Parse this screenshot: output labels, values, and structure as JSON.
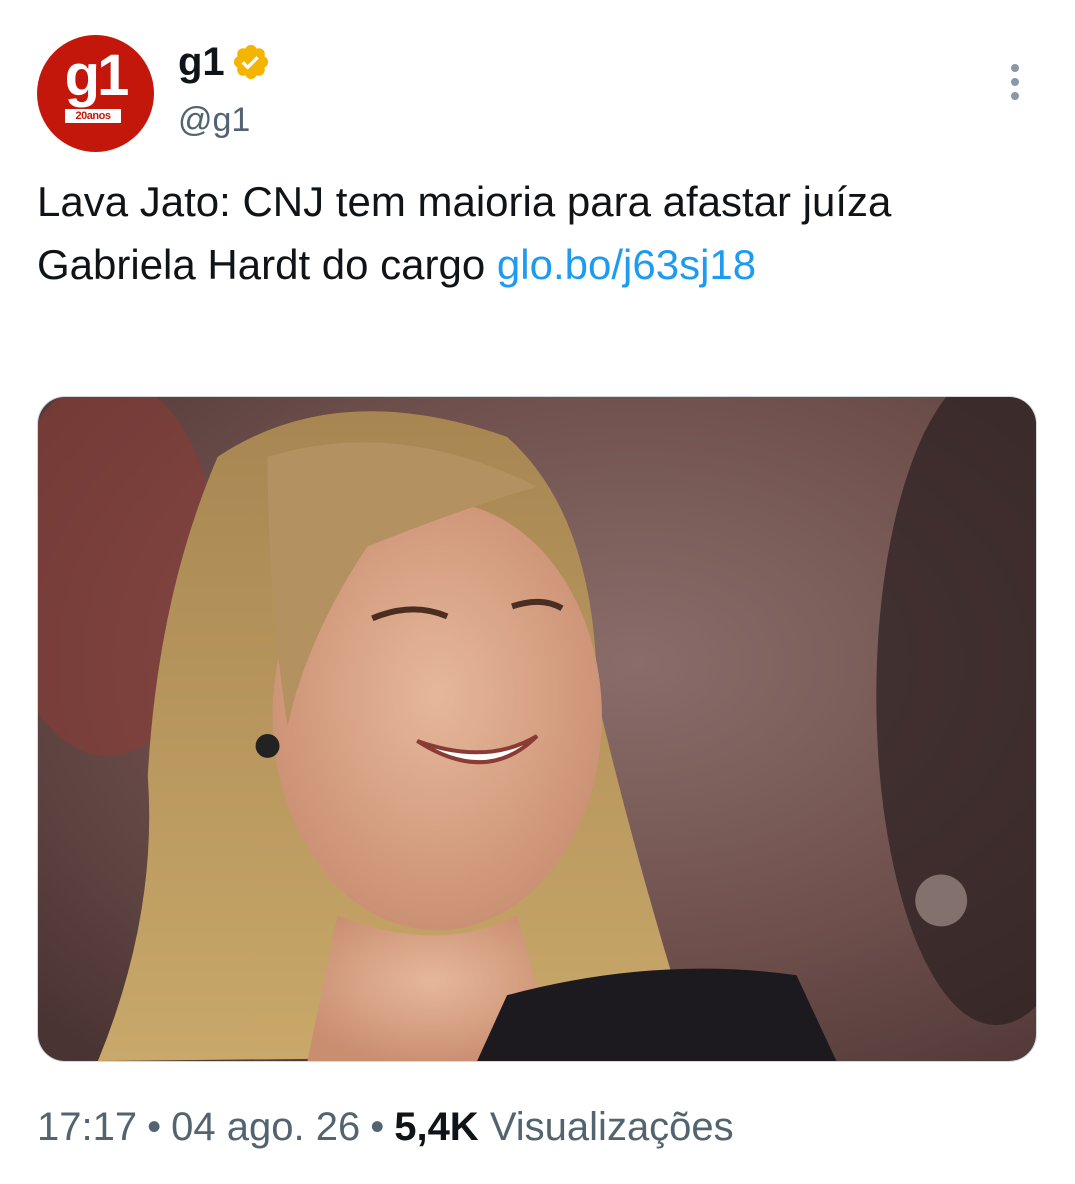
{
  "author": {
    "avatar_logo": "g1",
    "avatar_badge": "20anos",
    "display_name": "g1",
    "verified": true,
    "verified_color": "#f4b400",
    "handle": "@g1",
    "brand_color": "#c4170c"
  },
  "tweet": {
    "text": "Lava Jato: CNJ tem maioria para afastar juíza Gabriela Hardt do cargo ",
    "link": "glo.bo/j63sj18",
    "link_color": "#1d9bf0",
    "image_icon": "photo-of-smiling-woman"
  },
  "footer": {
    "time": "17:17",
    "separator": "•",
    "date": "04 ago. 26",
    "views_count": "5,4K",
    "views_label": "Visualizações"
  },
  "icons": {
    "more": "more-vertical-icon",
    "verified": "verified-badge-icon"
  }
}
